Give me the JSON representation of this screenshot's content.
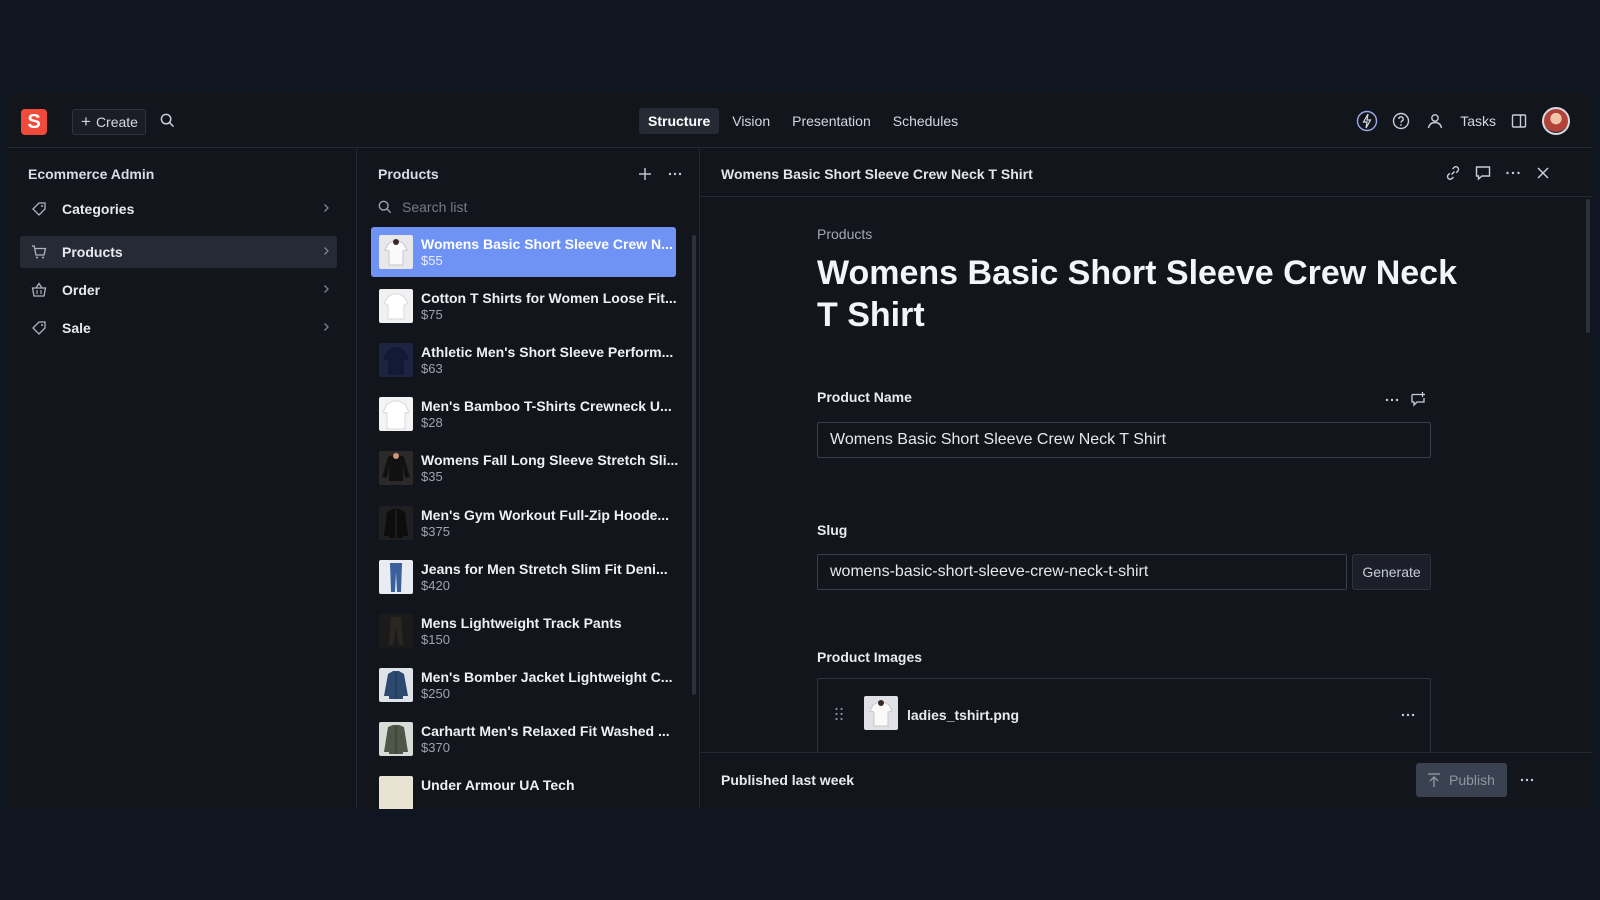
{
  "topbar": {
    "logo_letter": "S",
    "create_label": "Create",
    "nav": [
      {
        "label": "Structure",
        "active": true
      },
      {
        "label": "Vision",
        "active": false
      },
      {
        "label": "Presentation",
        "active": false
      },
      {
        "label": "Schedules",
        "active": false
      }
    ],
    "tasks_label": "Tasks",
    "icons": [
      "bolt-icon",
      "help-icon",
      "people-icon",
      "panel-icon"
    ]
  },
  "sidebar": {
    "title": "Ecommerce Admin",
    "items": [
      {
        "label": "Categories",
        "icon": "tag-icon",
        "active": false
      },
      {
        "label": "Products",
        "icon": "cart-icon",
        "active": true
      },
      {
        "label": "Order",
        "icon": "basket-icon",
        "active": false
      },
      {
        "label": "Sale",
        "icon": "tag-icon",
        "active": false
      }
    ]
  },
  "product_list": {
    "title": "Products",
    "search_placeholder": "Search list",
    "items": [
      {
        "name": "Womens Basic Short Sleeve Crew N...",
        "price": "$55",
        "thumb": "#e8e8ea"
      },
      {
        "name": "Cotton T Shirts for Women Loose Fit...",
        "price": "$75",
        "thumb": "#f1f1f1"
      },
      {
        "name": "Athletic Men's Short Sleeve Perform...",
        "price": "$63",
        "thumb": "#1c2442"
      },
      {
        "name": "Men's Bamboo T-Shirts Crewneck U...",
        "price": "$28",
        "thumb": "#f4f4f4"
      },
      {
        "name": "Womens Fall Long Sleeve Stretch Sli...",
        "price": "$35",
        "thumb": "#1a1a1a"
      },
      {
        "name": "Men's Gym Workout Full-Zip Hoode...",
        "price": "$375",
        "thumb": "#151515"
      },
      {
        "name": "Jeans for Men Stretch Slim Fit Deni...",
        "price": "$420",
        "thumb": "#3a5f9c"
      },
      {
        "name": "Mens Lightweight Track Pants",
        "price": "$150",
        "thumb": "#2a2622"
      },
      {
        "name": "Men's Bomber Jacket Lightweight C...",
        "price": "$250",
        "thumb": "#2c4a6e"
      },
      {
        "name": "Carhartt Men's Relaxed Fit Washed ...",
        "price": "$370",
        "thumb": "#4d5648"
      },
      {
        "name": "Under Armour UA Tech",
        "price": "",
        "thumb": "#e9e3d3"
      }
    ]
  },
  "document": {
    "header_title": "Womens Basic Short Sleeve Crew Neck T Shirt",
    "breadcrumb": "Products",
    "title": "Womens Basic Short Sleeve Crew Neck T Shirt",
    "fields": {
      "product_name_label": "Product Name",
      "product_name_value": "Womens Basic Short Sleeve Crew Neck T Shirt",
      "slug_label": "Slug",
      "slug_value": "womens-basic-short-sleeve-crew-neck-t-shirt",
      "generate_label": "Generate",
      "images_label": "Product Images",
      "image_file": "ladies_tshirt.png"
    },
    "footer": {
      "status": "Published last week",
      "publish_label": "Publish"
    }
  }
}
